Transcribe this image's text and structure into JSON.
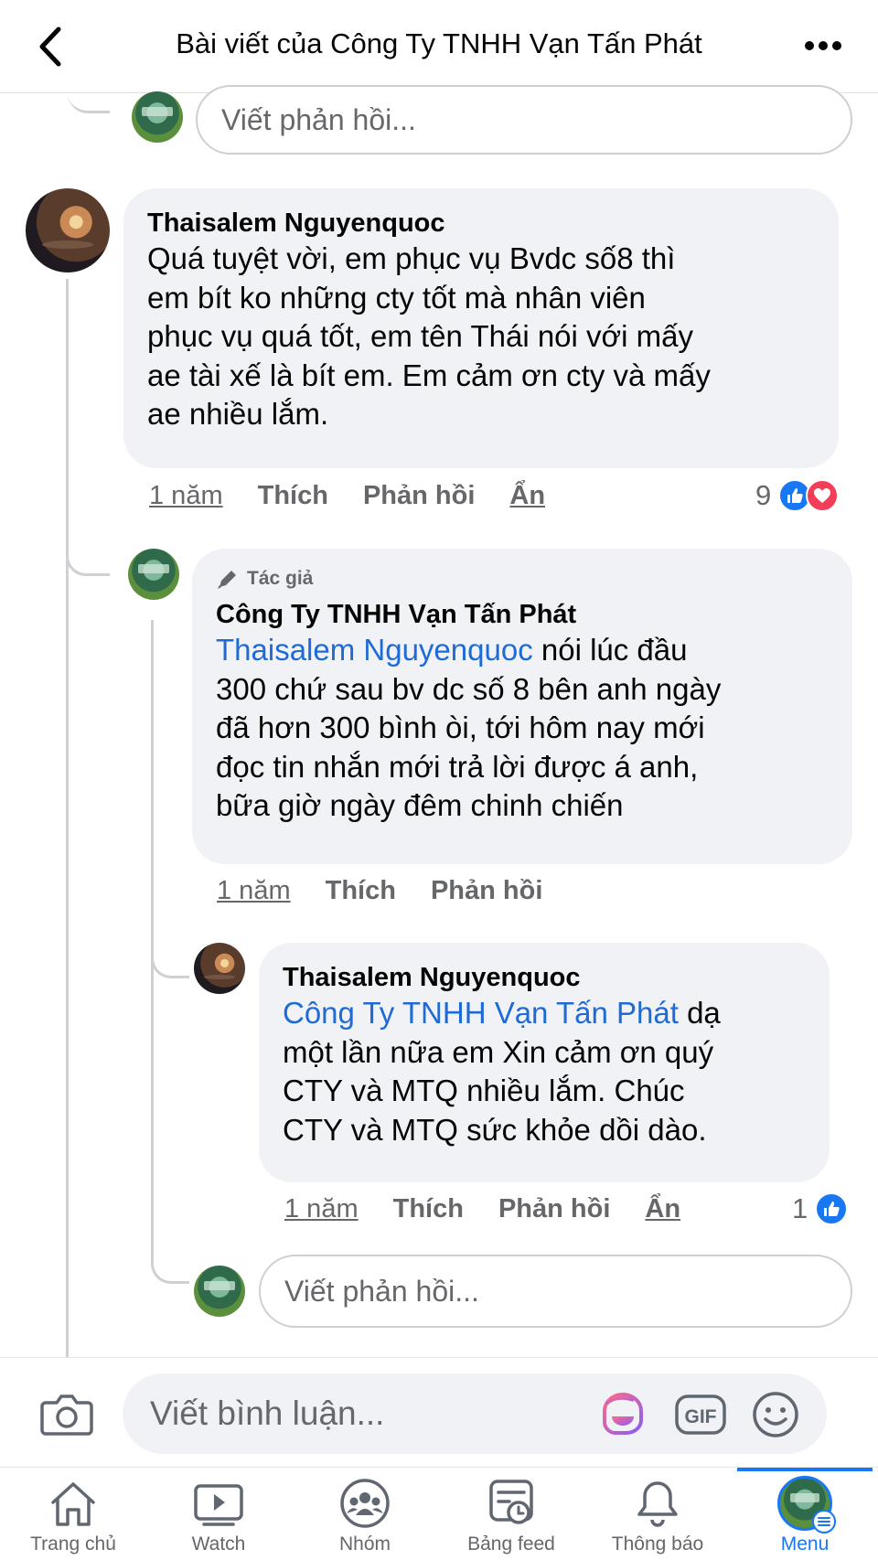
{
  "header": {
    "title": "Bài viết của Công Ty TNHH Vạn Tấn Phát"
  },
  "top_reply": {
    "placeholder": "Viết phản hồi..."
  },
  "comment_main": {
    "author": "Thaisalem Nguyenquoc",
    "lines": [
      "Quá tuyệt vời, em phục vụ Bvdc số8 thì",
      "em bít ko những cty tốt mà nhân viên",
      "phục vụ quá tốt, em tên Thái nói với mấy",
      "ae tài xế là bít em. Em cảm ơn cty và mấy",
      "ae nhiều lắm."
    ],
    "time": "1 năm",
    "like": "Thích",
    "reply": "Phản hồi",
    "hide": "Ẩn",
    "reaction_count": "9"
  },
  "reply_company": {
    "badge": "Tác giả",
    "author": "Công Ty TNHH Vạn Tấn Phát",
    "mention": "Thaisalem Nguyenquoc",
    "line1_rest": " nói lúc đầu",
    "lines": [
      "300 chứ sau bv dc số 8 bên anh ngày",
      "đã hơn 300 bình òi, tới hôm nay mới",
      "đọc tin nhắn mới trả lời được á anh,",
      "bữa giờ ngày đêm chinh chiến"
    ],
    "time": "1 năm",
    "like": "Thích",
    "reply": "Phản hồi"
  },
  "reply_user": {
    "author": "Thaisalem Nguyenquoc",
    "mention": "Công Ty TNHH Vạn Tấn Phát",
    "line1_rest": " dạ",
    "lines": [
      "một lần nữa em Xin cảm ơn  quý",
      "CTY và MTQ nhiều lắm. Chúc",
      "CTY và MTQ sức khỏe dồi dào."
    ],
    "time": "1 năm",
    "like": "Thích",
    "reply": "Phản hồi",
    "hide": "Ẩn",
    "reaction_count": "1"
  },
  "bottom_reply": {
    "placeholder": "Viết phản hồi..."
  },
  "composer": {
    "placeholder": "Viết bình luận...",
    "gif_label": "GIF"
  },
  "tabs": [
    {
      "label": "Trang chủ",
      "icon": "home-icon"
    },
    {
      "label": "Watch",
      "icon": "watch-icon"
    },
    {
      "label": "Nhóm",
      "icon": "groups-icon"
    },
    {
      "label": "Bảng feed",
      "icon": "feeds-icon"
    },
    {
      "label": "Thông báo",
      "icon": "bell-icon"
    },
    {
      "label": "Menu",
      "icon": "menu-avatar-icon",
      "active": true
    }
  ],
  "colors": {
    "accent": "#1877f2",
    "mention": "#1f6bd6",
    "bubble": "#f0f2f5",
    "love": "#f33e58"
  }
}
